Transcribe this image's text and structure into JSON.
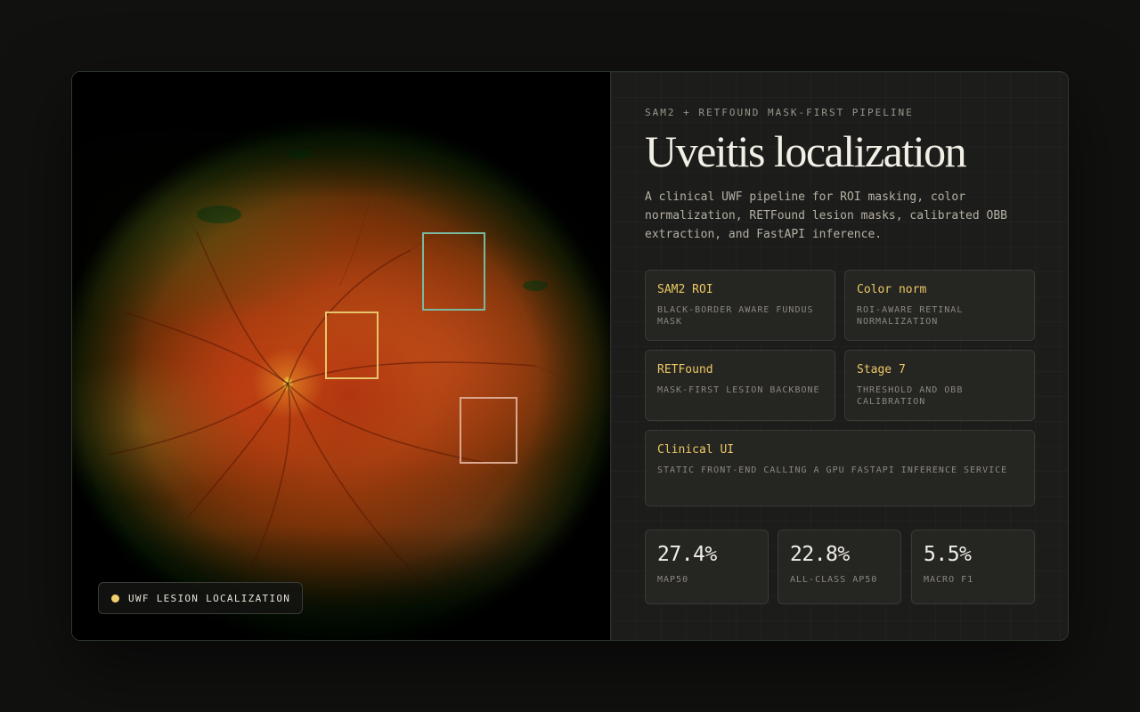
{
  "image_panel": {
    "legend": {
      "dot_color": "#f2cd6e",
      "label": "UWF LESION LOCALIZATION"
    },
    "detections": [
      {
        "color": "#7ab9a0"
      },
      {
        "color": "#e8c46a"
      },
      {
        "color": "#d9a88f"
      }
    ]
  },
  "info": {
    "eyebrow": "SAM2 + RETFOUND MASK-FIRST PIPELINE",
    "title": "Uveitis localization",
    "description": "A clinical UWF pipeline for ROI masking, color normalization, RETFound lesion masks, calibrated OBB extraction, and FastAPI inference.",
    "features": [
      {
        "title": "SAM2 ROI",
        "desc": "BLACK-BORDER AWARE FUNDUS MASK"
      },
      {
        "title": "Color norm",
        "desc": "ROI-AWARE RETINAL NORMALIZATION"
      },
      {
        "title": "RETFound",
        "desc": "MASK-FIRST LESION BACKBONE"
      },
      {
        "title": "Stage 7",
        "desc": "THRESHOLD AND OBB CALIBRATION"
      },
      {
        "title": "Clinical UI",
        "desc": "STATIC FRONT-END CALLING A GPU FASTAPI INFERENCE SERVICE"
      }
    ],
    "metrics": [
      {
        "value": "27.4%",
        "label": "MAP50"
      },
      {
        "value": "22.8%",
        "label": "ALL-CLASS AP50"
      },
      {
        "value": "5.5%",
        "label": "MACRO F1"
      }
    ],
    "accent_color": "#ecc863"
  }
}
